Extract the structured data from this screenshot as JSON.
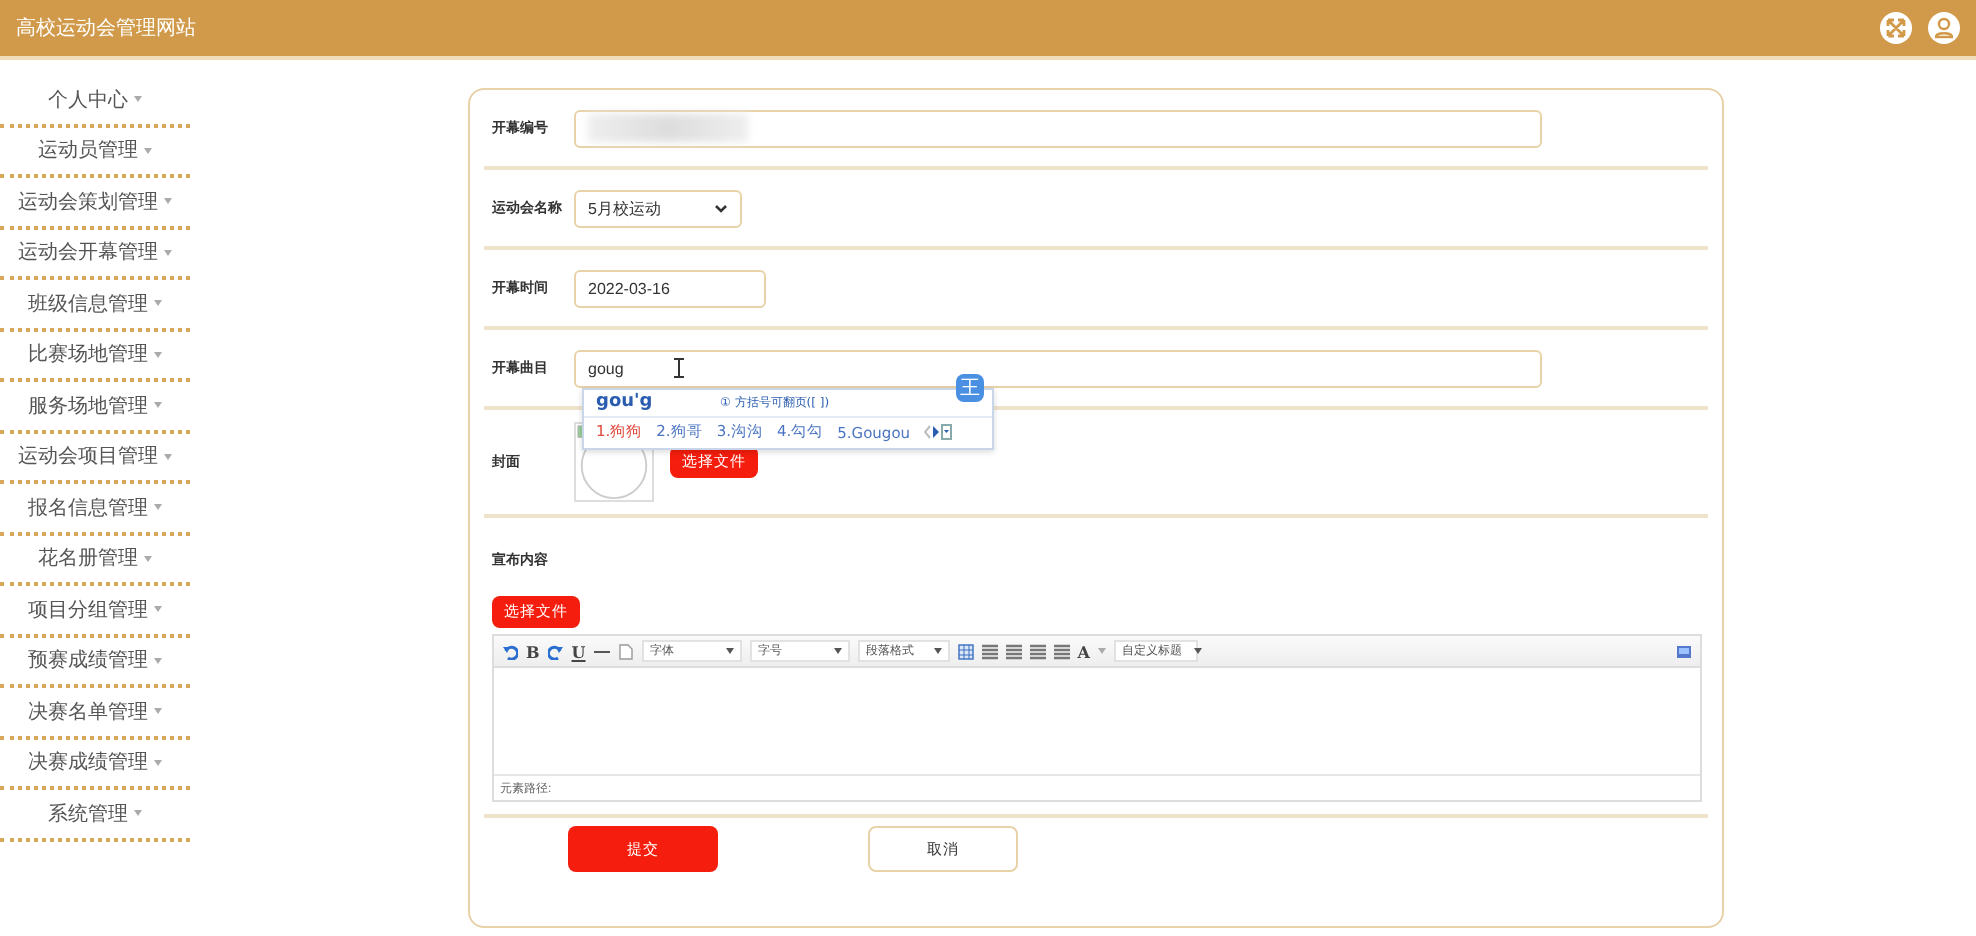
{
  "header": {
    "title": "高校运动会管理网站"
  },
  "sidebar": {
    "items": [
      {
        "label": "个人中心"
      },
      {
        "label": "运动员管理"
      },
      {
        "label": "运动会策划管理"
      },
      {
        "label": "运动会开幕管理"
      },
      {
        "label": "班级信息管理"
      },
      {
        "label": "比赛场地管理"
      },
      {
        "label": "服务场地管理"
      },
      {
        "label": "运动会项目管理"
      },
      {
        "label": "报名信息管理"
      },
      {
        "label": "花名册管理"
      },
      {
        "label": "项目分组管理"
      },
      {
        "label": "预赛成绩管理"
      },
      {
        "label": "决赛名单管理"
      },
      {
        "label": "决赛成绩管理"
      },
      {
        "label": "系统管理"
      }
    ]
  },
  "form": {
    "opening_number": {
      "label": "开幕编号"
    },
    "meet_name": {
      "label": "运动会名称",
      "value": "5月校运动"
    },
    "opening_time": {
      "label": "开幕时间",
      "value": "2022-03-16"
    },
    "opening_song": {
      "label": "开幕曲目",
      "value": "goug"
    },
    "ime": {
      "composition": "gou'g",
      "hint": "① 方括号可翻页([ ])",
      "badge": "王",
      "candidates": [
        {
          "text": "1.狗狗",
          "selected": true
        },
        {
          "text": "2.狗哥",
          "selected": false
        },
        {
          "text": "3.沟沟",
          "selected": false
        },
        {
          "text": "4.勾勾",
          "selected": false
        },
        {
          "text": "5.Gougou",
          "selected": false
        }
      ]
    },
    "cover": {
      "label": "封面",
      "button": "选择文件"
    },
    "content": {
      "label": "宣布内容",
      "button": "选择文件",
      "toolbar": {
        "bold": "B",
        "underline": "U",
        "font_color": "A",
        "selects": [
          "字体",
          "字号",
          "段落格式",
          "自定义标题"
        ]
      },
      "path_label": "元素路径:"
    },
    "submit": "提交",
    "cancel": "取消"
  }
}
